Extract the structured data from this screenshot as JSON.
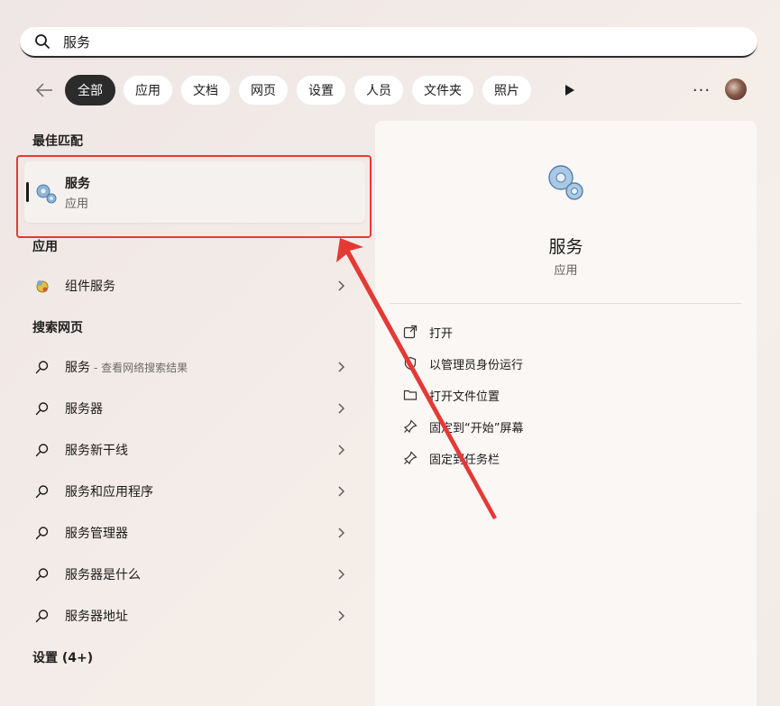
{
  "search": {
    "value": "服务"
  },
  "filters": [
    "全部",
    "应用",
    "文档",
    "网页",
    "设置",
    "人员",
    "文件夹",
    "照片"
  ],
  "more_label": "···",
  "best_match": {
    "heading": "最佳匹配",
    "title": "服务",
    "subtitle": "应用"
  },
  "apps": {
    "heading": "应用",
    "items": [
      {
        "label": "组件服务"
      }
    ]
  },
  "web": {
    "heading": "搜索网页",
    "items": [
      {
        "label": "服务",
        "hint": "- 查看网络搜索结果"
      },
      {
        "label": "服务器",
        "hint": ""
      },
      {
        "label": "服务新干线",
        "hint": ""
      },
      {
        "label": "服务和应用程序",
        "hint": ""
      },
      {
        "label": "服务管理器",
        "hint": ""
      },
      {
        "label": "服务器是什么",
        "hint": ""
      },
      {
        "label": "服务器地址",
        "hint": ""
      }
    ]
  },
  "settings": {
    "heading": "设置 (4+)"
  },
  "detail": {
    "name": "服务",
    "type": "应用",
    "actions": [
      {
        "label": "打开",
        "icon": "open-external-icon"
      },
      {
        "label": "以管理员身份运行",
        "icon": "shield-icon"
      },
      {
        "label": "打开文件位置",
        "icon": "folder-icon"
      },
      {
        "label": "固定到“开始”屏幕",
        "icon": "pin-icon"
      },
      {
        "label": "固定到任务栏",
        "icon": "pin-icon"
      }
    ]
  },
  "colors": {
    "highlight": "#e53935",
    "active_chip": "#2b2b2b"
  }
}
